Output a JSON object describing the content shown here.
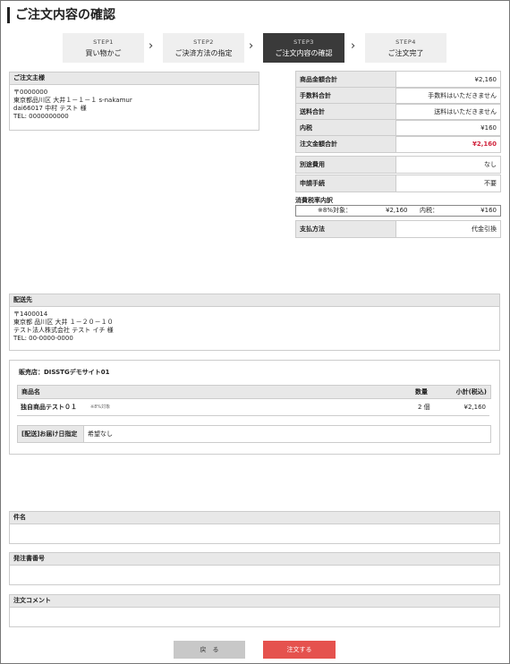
{
  "page_title": "ご注文内容の確認",
  "steps": [
    {
      "num": "STEP1",
      "label": "買い物かご"
    },
    {
      "num": "STEP2",
      "label": "ご決済方法の指定"
    },
    {
      "num": "STEP3",
      "label": "ご注文内容の確認"
    },
    {
      "num": "STEP4",
      "label": "ご注文完了"
    }
  ],
  "orderer": {
    "header": "ご注文主様",
    "lines": [
      "〒0000000",
      "東京都品川区 大井１－１－１ s-nakamur",
      "dai66017 中村 テスト 様",
      "TEL: 0000000000"
    ]
  },
  "summary": [
    {
      "label": "商品金額合計",
      "value": "¥2,160"
    },
    {
      "label": "手数料合計",
      "value": "手数料はいただきません"
    },
    {
      "label": "送料合計",
      "value": "送料はいただきません"
    },
    {
      "label": "内税",
      "value": "¥160"
    },
    {
      "label": "注文金額合計",
      "value": "¥2,160"
    }
  ],
  "extra": [
    {
      "label": "別途費用",
      "value": "なし"
    },
    {
      "label": "申請手続",
      "value": "不要"
    }
  ],
  "tax_breakdown": {
    "title": "消費税率内訳",
    "target": "※8%対象：",
    "target_value": "¥2,160",
    "inner_label": "内税：",
    "inner_value": "¥160"
  },
  "payment": {
    "label": "支払方法",
    "value": "代金引換"
  },
  "shipping": {
    "header": "配送先",
    "lines": [
      "〒1400014",
      "東京都 品川区 大井 １－２０－１０",
      "テスト法人株式会社 テスト イチ 様",
      "TEL: 00-0000-0000"
    ]
  },
  "store": {
    "label": "販売店：DISSTGデモサイト01",
    "col_name": "商品名",
    "col_qty": "数量",
    "col_subtotal": "小計(税込)",
    "item_name": "独自商品テスト０１",
    "item_tax": "※8%対象",
    "item_qty": "2 個",
    "item_subtotal": "¥2,160",
    "delivery_label": "[配送]お届け日指定",
    "delivery_value": "希望なし"
  },
  "fields": {
    "subject": "件名",
    "po_number": "発注書番号",
    "comment": "注文コメント"
  },
  "buttons": {
    "back": "戻　る",
    "order": "注文する"
  },
  "colors": {
    "accent_red": "#d0243d",
    "button_red": "#e5524e",
    "button_gray": "#c8c8c8"
  }
}
